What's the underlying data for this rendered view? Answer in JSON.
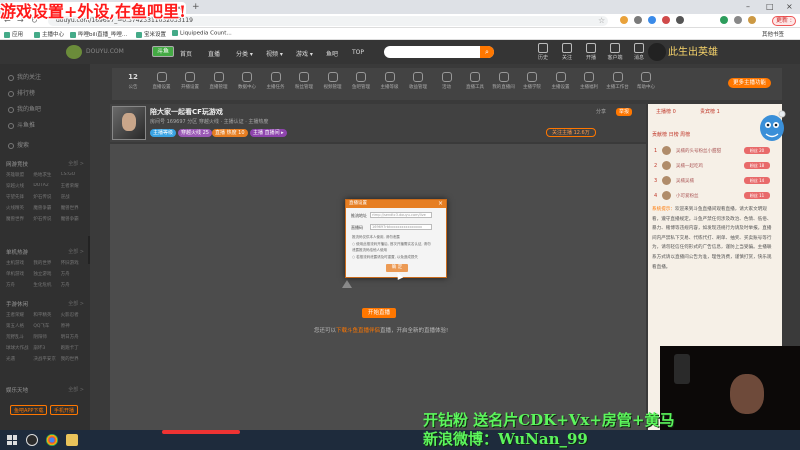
{
  "overlay": {
    "title": "游戏设置+外设,在鱼吧里!",
    "promo_line1": "开钻粉 送名片CDK+Vx+房管+黄马",
    "promo_line2": "新浪微博：WuNan_99"
  },
  "browser": {
    "tab_close": "×",
    "new_tab": "+",
    "url": "douyu.com/169697_=0.37423311032033119",
    "user_badge": "更新 :",
    "bookmarks": [
      {
        "label": "应用"
      },
      {
        "label": "主播中心"
      },
      {
        "label": "哔哩bili直播_哔哩..."
      },
      {
        "label": "宝米设置"
      },
      {
        "label": "Liquipedia Count..."
      }
    ],
    "other_bookmarks": "其他书签"
  },
  "site": {
    "logo_text": "DOUYU.COM",
    "logo_box": "斗鱼",
    "nav": [
      "首页",
      "直播",
      "分类 ▾",
      "视频 ▾",
      "游戏 ▾",
      "鱼吧",
      "TOP"
    ],
    "header_icons": [
      "历史",
      "关注",
      "开播",
      "客户端",
      "消息",
      "登录"
    ],
    "banner": "此生出英雄"
  },
  "sidebar": {
    "items": [
      "我的关注",
      "排行榜",
      "我的鱼吧",
      "斗鱼推",
      "搜索"
    ],
    "section1": {
      "title": "网游竞技",
      "more": "全部 >",
      "games": [
        "英雄联盟",
        "绝地求生",
        "CS:GO",
        "穿越火线",
        "DOTA2",
        "王者荣耀",
        "守望先锋",
        "炉石传说",
        "逆战",
        "火线精英",
        "魔兽争霸",
        "魔兽世界",
        "魔兽世界",
        "炉石传说",
        "魔兽争霸"
      ]
    },
    "section2": {
      "title": "单机热游",
      "more": "全部 >",
      "games": [
        "主机游戏",
        "我的世界",
        "怀旧游戏",
        "单机游戏",
        "独立游戏",
        "方舟",
        "方舟",
        "生化危机",
        "方舟"
      ]
    },
    "section3": {
      "title": "手游休闲",
      "more": "全部 >",
      "games": [
        "王者荣耀",
        "和平精英",
        "火影忍者",
        "第五人格",
        "QQ飞车",
        "原神",
        "荒野乱斗",
        "阴阳师",
        "明日方舟",
        "球球大作战",
        "崩坏3",
        "跑跑卡丁",
        "光遇",
        "决战平安京",
        "我的世界"
      ]
    },
    "section4": {
      "title": "娱乐天地",
      "more": "全部 >"
    },
    "btn_app": "鱼吧APP下载",
    "btn_stream": "手机开播"
  },
  "categories": [
    {
      "top": "12",
      "label": "公告"
    },
    {
      "label": "直播设置"
    },
    {
      "label": "开播设置"
    },
    {
      "label": "直播管理"
    },
    {
      "label": "数据中心"
    },
    {
      "label": "主播任务"
    },
    {
      "label": "粉丝管理"
    },
    {
      "label": "视频管理"
    },
    {
      "label": "鱼吧管理"
    },
    {
      "label": "主播等级"
    },
    {
      "label": "收益管理"
    },
    {
      "label": "活动"
    },
    {
      "label": "直播工具"
    },
    {
      "label": "我的直播间"
    },
    {
      "label": "主播学院"
    },
    {
      "label": "主播设置"
    },
    {
      "label": "主播福利"
    },
    {
      "label": "主播工作台"
    },
    {
      "label": "帮助中心"
    }
  ],
  "category_more": "更多主播功能",
  "room": {
    "title": "陪大家一起看CF玩游戏",
    "meta": "房间号 169697  分区 穿越火线  ·  主播认证  ·  主播热度",
    "tags": [
      {
        "label": "主播等级",
        "color": "#3aa3e3"
      },
      {
        "label": "穿越火线 25",
        "color": "#9b59b6"
      },
      {
        "label": "直播 热度 10",
        "color": "#e67e22"
      },
      {
        "label": "主播 直播间 ▸",
        "color": "#8e44ad"
      }
    ],
    "follow": "关注主播 12.6万",
    "share": "分享",
    "report": "举报"
  },
  "dialog": {
    "title": "直播设置",
    "close": "×",
    "row1_label": "推流地址",
    "row1_value": "rtmp://sendtc3.douyu.com/live",
    "row2_label": "直播码",
    "row2_value": "169697rbkxxxxxxxxxxxxxxx",
    "note1": "推流码仅供本人使用, 请勿泄露",
    "note2": "○ 使用此推流码开播后, 首次开播需实名认证, 请勿",
    "note3": "  泄露推流码给他人使用",
    "note4": "○ 若推流码泄露请及时重置, 以免造成损失",
    "ok": "确 定"
  },
  "video": {
    "notice_btn": "开始直播",
    "notice_text_prefix": "您还可以",
    "notice_text_link": "下载斗鱼直播伴侣",
    "notice_text_suffix": "直播，开启全新的直播体验!"
  },
  "chat": {
    "tab1": "主播榜 0",
    "tab2": "贵宾榜 1",
    "rank_title": "贡献榜 日榜 周榜",
    "ranks": [
      {
        "no": "1",
        "name": "吴楠的头号粉丝小甜甜",
        "badge": "粉丝 20"
      },
      {
        "no": "2",
        "name": "吴楠一起吃鸡",
        "badge": "粉丝 18"
      },
      {
        "no": "3",
        "name": "吴楠吴楠",
        "badge": "粉丝 14"
      },
      {
        "no": "4",
        "name": "小可爱粉丝",
        "badge": "粉丝 11"
      }
    ],
    "message_sys": "系统提示：",
    "message_body": "欢迎来到斗鱼直播间观看直播，请大家文明观看，遵守直播规定。斗鱼严禁任何涉及政治、色情、低俗、暴力、赌博等违规内容，如发现违规行为请及时举报。直播间内严禁私下交易、代练代打、刷单、抽奖、买卖账号等行为，请勿轻信任何形式的广告信息，谨防上当受骗。主播联系方式请以直播间公告为准，理性消费，谨慎打赏，快乐观看直播。"
  },
  "colors": {
    "accent": "#ff7700",
    "overlay_red": "#ff1a1a",
    "promo_green": "#5cf55c"
  },
  "icons": {
    "back": "back-arrow-icon",
    "forward": "forward-arrow-icon",
    "reload": "reload-icon",
    "star": "star-icon",
    "search": "search-icon",
    "windows": "windows-logo-icon"
  }
}
